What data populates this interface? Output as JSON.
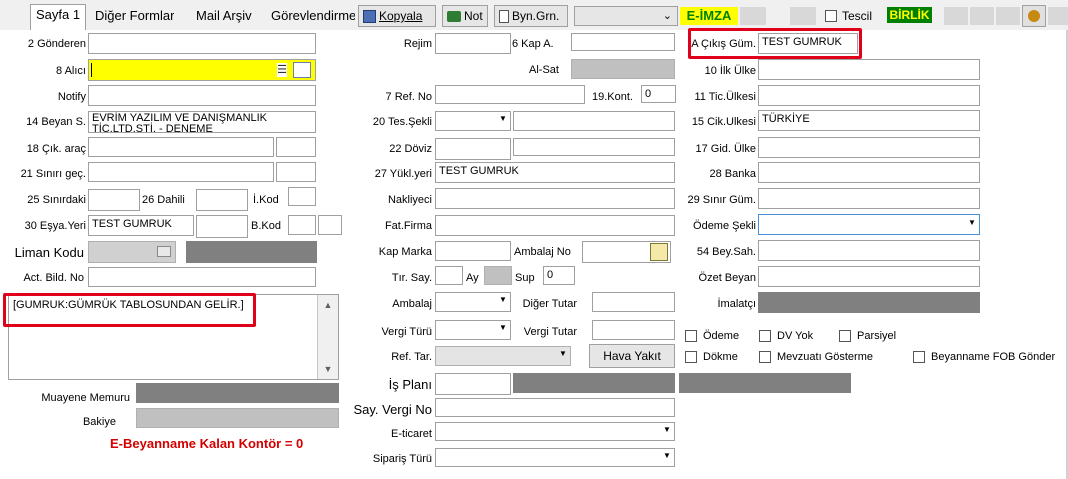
{
  "tabs": {
    "sayfa1": "Sayfa 1",
    "diger_formlar": "Diğer Formlar",
    "mail_arsiv": "Mail Arşiv",
    "gorevlendirme": "Görevlendirme"
  },
  "toolbar": {
    "kopyala": "Kopyala",
    "not": "Not",
    "byn_grn": "Byn.Grn.",
    "e_imza": "E-İMZA",
    "tescil": "Tescil",
    "birlik": "BİRLİK"
  },
  "left": {
    "gonderen": "2 Gönderen",
    "alici": "8 Alıcı",
    "notify": "Notify",
    "beyan_s": "14 Beyan S.",
    "beyan_s_value_1": "EVRİM YAZILIM VE DANIŞMANLIK",
    "beyan_s_value_2": "TİC.LTD.ŞTİ. - DENEME",
    "cik_arac": "18 Çık. araç",
    "sinir_gec": "21 Sınırı geç.",
    "sinirdaki": "25 Sınırdaki",
    "dahili": "26 Dahili",
    "i_kod": "İ.Kod",
    "esya_yeri": "30 Eşya.Yeri",
    "esya_yeri_value": "TEST GUMRUK",
    "b_kod": "B.Kod",
    "liman_kodu": "Liman Kodu",
    "act_bild_no": "Act. Bild. No",
    "memo_text": "[GUMRUK:GÜMRÜK TABLOSUNDAN GELİR.]",
    "muayene_memuru": "Muayene Memuru",
    "bakiye": "Bakiye",
    "kontor": "E-Beyanname Kalan Kontör = 0"
  },
  "middle": {
    "rejim": "Rejim",
    "kap_a": "6 Kap A.",
    "al_sat": "Al-Sat",
    "ref_no": "7 Ref. No",
    "kont": "19.Kont.",
    "kont_value": "0",
    "tes_sekli": "20 Tes.Şekli",
    "doviz": "22 Döviz",
    "yukl_yeri": "27 Yükl.yeri",
    "yukl_yeri_value": "TEST GUMRUK",
    "nakliyeci": "Nakliyeci",
    "fat_firma": "Fat.Firma",
    "kap_marka": "Kap Marka",
    "ambalaj_no": "Ambalaj No",
    "tir_say": "Tır. Say.",
    "ay": "Ay",
    "sup": "Sup",
    "sup_value": "0",
    "ambalaj": "Ambalaj",
    "diger_tutar": "Diğer Tutar",
    "vergi_turu": "Vergi Türü",
    "vergi_tutar": "Vergi Tutar",
    "ref_tar": "Ref. Tar.",
    "hava_yakit": "Hava Yakıt",
    "is_plani": "İş Planı",
    "say_vergi_no": "Say. Vergi No",
    "e_ticaret": "E-ticaret",
    "siparis_turu": "Sipariş Türü"
  },
  "right": {
    "a_cikis_gum": "A Çıkış Güm.",
    "a_cikis_gum_value": "TEST GUMRUK",
    "ilk_ulke": "10 İlk Ülke",
    "tic_ulkesi": "11 Tic.Ülkesi",
    "cik_ulkesi": "15 Cik.Ulkesi",
    "cik_ulkesi_value": "TÜRKİYE",
    "gid_ulke": "17 Gid. Ülke",
    "banka": "28 Banka",
    "sinir_gum": "29 Sınır Güm.",
    "odeme_sekli": "Ödeme Şekli",
    "bey_sah": "54 Bey.Sah.",
    "ozet_beyan": "Özet Beyan",
    "imalatci": "İmalatçı",
    "odeme": "Ödeme",
    "dv_yok": "DV Yok",
    "parsiyel": "Parsiyel",
    "dokme": "Dökme",
    "mevzuati_gosterme": "Mevzuatı Gösterme",
    "beyanname_fob": "Beyanname FOB Gönder"
  },
  "colors": {
    "highlight_red": "#e0001a",
    "alici_yellow": "#ffff00",
    "kontor_red": "#d40000",
    "birlik_green": "#008000",
    "eimza_yellow": "#ffff00"
  }
}
